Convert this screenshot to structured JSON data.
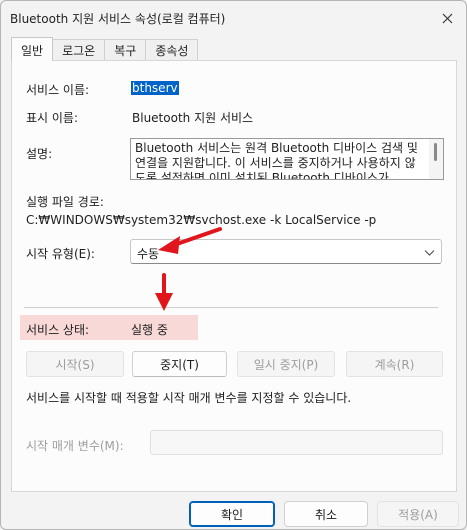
{
  "window": {
    "title": "Bluetooth 지원 서비스 속성(로컬 컴퓨터)"
  },
  "tabs": [
    {
      "label": "일반"
    },
    {
      "label": "로그온"
    },
    {
      "label": "복구"
    },
    {
      "label": "종속성"
    }
  ],
  "general": {
    "service_name_label": "서비스 이름:",
    "service_name_value": "bthserv",
    "display_name_label": "표시 이름:",
    "display_name_value": "Bluetooth 지원 서비스",
    "description_label": "설명:",
    "description_value": "Bluetooth 서비스는 원격 Bluetooth 디바이스 검색 및 연결을 지원합니다. 이 서비스를 중지하거나 사용하지 않도록 설정하면 이미 설치된 Bluetooth 디바이스가",
    "exe_path_label": "실행 파일 경로:",
    "exe_path_value": "C:₩WINDOWS₩system32₩svchost.exe -k LocalService -p",
    "startup_type_label": "시작 유형(E):",
    "startup_type_value": "수동",
    "status_label": "서비스 상태:",
    "status_value": "실행 중",
    "buttons": {
      "start": "시작(S)",
      "stop": "중지(T)",
      "pause": "일시 중지(P)",
      "resume": "계속(R)"
    },
    "hint_text": "서비스를 시작할 때 적용할 시작 매개 변수를 지정할 수 있습니다.",
    "start_params_label": "시작 매개 변수(M):",
    "start_params_value": ""
  },
  "footer": {
    "ok": "확인",
    "cancel": "취소",
    "apply": "적용(A)"
  },
  "colors": {
    "accent": "#005fb8",
    "annotation_arrow": "#e0161c",
    "status_highlight": "#f9d8d8"
  }
}
